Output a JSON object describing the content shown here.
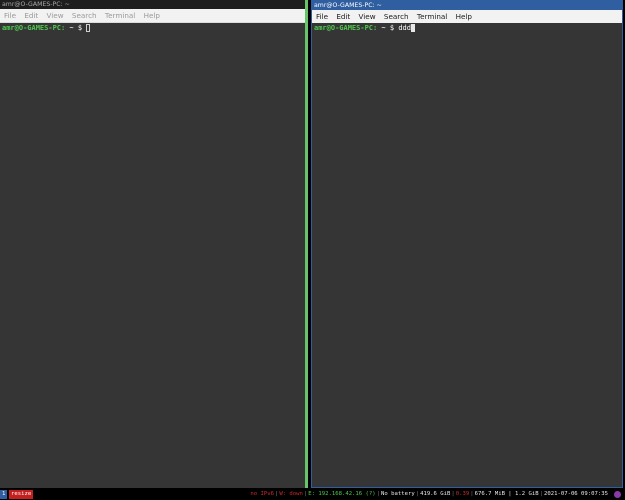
{
  "left_window": {
    "title": "amr@O-GAMES-PC: ~",
    "menu": [
      "File",
      "Edit",
      "View",
      "Search",
      "Terminal",
      "Help"
    ],
    "prompt_user": "amr@O-GAMES-PC:",
    "prompt_path": " ~",
    "prompt_symbol": " $ ",
    "typed": ""
  },
  "right_window": {
    "title": "amr@O-GAMES-PC: ~",
    "menu": [
      "File",
      "Edit",
      "View",
      "Search",
      "Terminal",
      "Help"
    ],
    "prompt_user": "amr@O-GAMES-PC:",
    "prompt_path": " ~",
    "prompt_symbol": " $ ",
    "typed": "ddd"
  },
  "statusbar": {
    "workspace": "1",
    "mode": "resize",
    "ipv6": "no IPv6",
    "wireless": "W: down",
    "ethernet": "E: 192.168.42.16 (?)",
    "battery": "No battery",
    "disk": "419.6 GiB",
    "load": "0.39",
    "memory": "676.7 MiB | 1.2 GiB",
    "datetime": "2021-07-06 09:07:35"
  },
  "colors": {
    "terminal_bg": "#353535",
    "prompt_green": "#4ec94e",
    "focused_title": "#2f5fa0",
    "status_red": "#cc2a2a"
  }
}
